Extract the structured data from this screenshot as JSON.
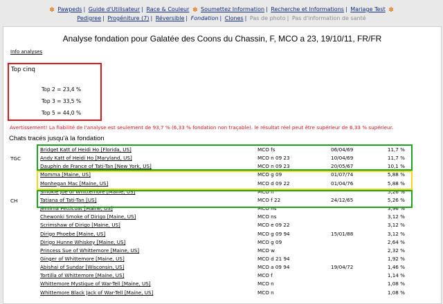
{
  "nav": {
    "line1": [
      {
        "label": "Pawpeds"
      },
      {
        "label": "Guide d'Utilisateur"
      },
      {
        "label": "Race & Couleur"
      },
      {
        "label": "Soumettez Information"
      },
      {
        "label": "Recherche et Informations"
      },
      {
        "label": "Mariage Test"
      }
    ],
    "line2": [
      {
        "label": "Pedigree",
        "state": "link"
      },
      {
        "label": "Progéniture (7)",
        "state": "link"
      },
      {
        "label": "Réversible",
        "state": "link"
      },
      {
        "label": "Fondation",
        "state": "current"
      },
      {
        "label": "Clones",
        "state": "link"
      },
      {
        "label": "Pas de photo",
        "state": "disabled"
      },
      {
        "label": "Pas d'information de santé",
        "state": "disabled"
      }
    ]
  },
  "title": "Analyse fondation pour Galatée des Coons du Chassin, F, MCO a 23, 19/10/11, FR/FR",
  "info_link": "Info analyses",
  "top": {
    "heading": "Top cinq",
    "rows": [
      "Top 2 = 23,4 %",
      "Top 3 = 33,5 %",
      "Top 5 = 44,0 %"
    ]
  },
  "warning": "Avertissement! La fiabilité de l'analyse est seulement de 93,7 % (6,33 % fondation non traçable). le résultat réel peut être supérieur de 6,33 % supérieur.",
  "traced_heading": "Chats tracés jusqu'à la fondation",
  "cats": [
    {
      "group": "",
      "name": "Bridget Katt of Heidi Ho [Florida, US]",
      "breed": "MCO fs",
      "date": "06/04/69",
      "pct": "11,7 %"
    },
    {
      "group": "TGC",
      "name": "Andy Katt of Heidi Ho [Maryland, US]",
      "breed": "MCO n 09 23",
      "date": "10/04/69",
      "pct": "11,7 %"
    },
    {
      "group": "",
      "name": "Dauphin de France of Tati-Tan [New York, US]",
      "breed": "MCO n 09 23",
      "date": "20/05/67",
      "pct": "10,1 %"
    },
    {
      "group": "",
      "name": "Momma [Maine, US]",
      "breed": "MCO g 09",
      "date": "01/07/74",
      "pct": "5,88 %"
    },
    {
      "group": "",
      "name": "Monhegan Mac [Maine, US]",
      "breed": "MCO d 09 22",
      "date": "01/04/76",
      "pct": "5,88 %"
    },
    {
      "group": "",
      "name": "Smokie Joe of Whittemore [Maine, US]",
      "breed": "MCO n",
      "date": "",
      "pct": "5,26 %"
    },
    {
      "group": "CH",
      "name": "Tatiana of Tati-Tan [US]",
      "breed": "MCO f 22",
      "date": "24/12/65",
      "pct": "5,26 %"
    },
    {
      "group": "",
      "name": "Jemima Petticoat [Maine, US]",
      "breed": "MCO ns",
      "date": "",
      "pct": "3,96 %"
    },
    {
      "group": "",
      "name": "Chewonki Smoke of Dirigo [Maine, US]",
      "breed": "MCO ns",
      "date": "",
      "pct": "3,12 %"
    },
    {
      "group": "",
      "name": "Scrimshaw of Dirigo [Maine, US]",
      "breed": "MCO e 09 22",
      "date": "",
      "pct": "3,12 %"
    },
    {
      "group": "",
      "name": "Dirigo Phoebe [Maine, US]",
      "breed": "MCO g 09 94",
      "date": "15/01/88",
      "pct": "3,12 %"
    },
    {
      "group": "",
      "name": "Dirigo Hunne Whiskey [Maine, US]",
      "breed": "MCO g 09",
      "date": "",
      "pct": "2,64 %"
    },
    {
      "group": "",
      "name": "Princess Sue of Whittemore [Maine, US]",
      "breed": "MCO w",
      "date": "",
      "pct": "2,32 %"
    },
    {
      "group": "",
      "name": "Ginger of Whittemore [Maine, US]",
      "breed": "MCO d 21 94",
      "date": "",
      "pct": "1,92 %"
    },
    {
      "group": "",
      "name": "Abishai of Sundar [Wisconsin, US]",
      "breed": "MCO a 09 94",
      "date": "19/04/72",
      "pct": "1,46 %"
    },
    {
      "group": "",
      "name": "Tortilla of Whittemore [Maine, US]",
      "breed": "MCO f",
      "date": "",
      "pct": "1,14 %"
    },
    {
      "group": "",
      "name": "Whittemore Mystique of War-Tell [Maine, US]",
      "breed": "MCO n",
      "date": "",
      "pct": "1,08 %"
    },
    {
      "group": "",
      "name": "Whittemore Black Jack of War-Tell [Maine, US]",
      "breed": "MCO n",
      "date": "",
      "pct": "1,08 %"
    }
  ],
  "colors": {
    "link": "#102a7a",
    "warning": "#e0141b",
    "green_box": "#1aa51a",
    "yellow_box": "#f2d814",
    "paw": "#e07b1a"
  }
}
